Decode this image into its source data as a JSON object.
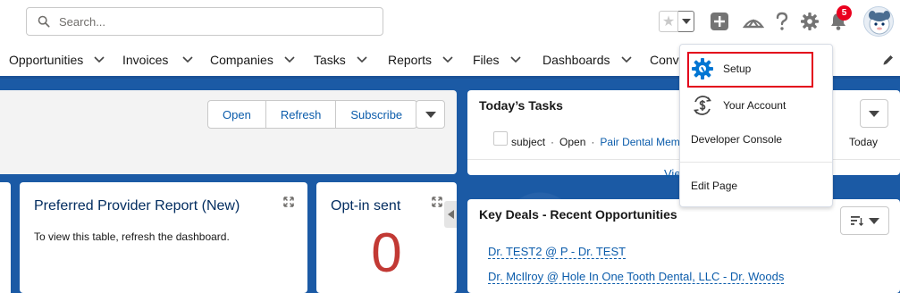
{
  "header": {
    "search_placeholder": "Search...",
    "notifications_count": "5",
    "icons": [
      "search-icon",
      "star-icon",
      "chevron-down-icon",
      "add-icon",
      "trailhead-icon",
      "help-icon",
      "gear-icon",
      "bell-icon",
      "avatar"
    ]
  },
  "nav": {
    "items": [
      {
        "label": "Opportunities"
      },
      {
        "label": "Invoices"
      },
      {
        "label": "Companies"
      },
      {
        "label": "Tasks"
      },
      {
        "label": "Reports"
      },
      {
        "label": "Files"
      },
      {
        "label": "Dashboards"
      },
      {
        "label": "Conve"
      }
    ]
  },
  "dashboard_toolbar": {
    "open_label": "Open",
    "refresh_label": "Refresh",
    "subscribe_label": "Subscribe"
  },
  "ppr_card": {
    "title": "Preferred Provider Report (New)",
    "body": "To view this table, refresh the dashboard."
  },
  "optin_card": {
    "title": "Opt-in sent",
    "value": "0"
  },
  "tasks_card": {
    "title": "Today’s Tasks",
    "task": {
      "subject": "subject",
      "status": "Open",
      "related": "Pair Dental Memb"
    },
    "date": "Today",
    "view_all": "Vie"
  },
  "deals_card": {
    "title": "Key Deals - Recent Opportunities",
    "deals": [
      {
        "label": "Dr. TEST2 @ P - Dr. TEST"
      },
      {
        "label": "Dr. McIlroy @ Hole In One Tooth Dental, LLC - Dr. Woods"
      }
    ]
  },
  "setup_menu": {
    "items": [
      {
        "label": "Setup"
      },
      {
        "label": "Your Account"
      },
      {
        "label": "Developer Console"
      },
      {
        "label": "Edit Page"
      }
    ]
  },
  "colors": {
    "brand_blue": "#1b5aa5",
    "link": "#0b5cab",
    "highlight": "#e3001b",
    "big_number": "#c23934",
    "badge": "#ea001e"
  }
}
